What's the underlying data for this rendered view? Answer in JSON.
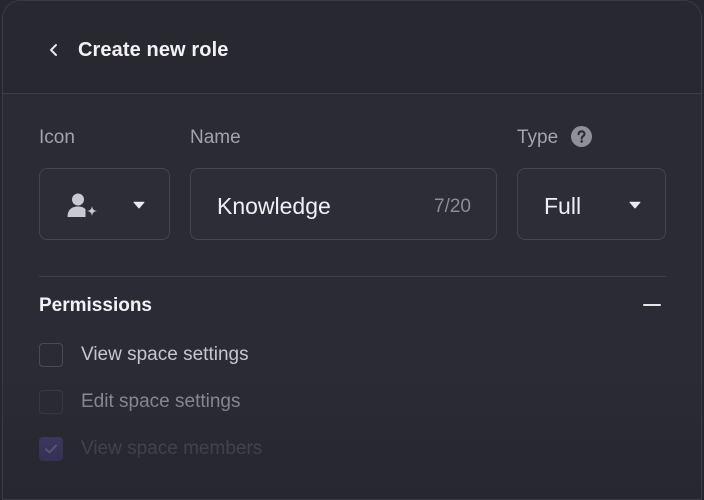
{
  "header": {
    "title": "Create new role",
    "back_icon": "chevron-left-icon"
  },
  "form": {
    "icon_label": "Icon",
    "icon_value": "user-plus-icon",
    "name_label": "Name",
    "name_value": "Knowledge",
    "name_counter": "7/20",
    "type_label": "Type",
    "type_value": "Full"
  },
  "permissions": {
    "title": "Permissions",
    "items": [
      {
        "label": "View space settings",
        "checked": false
      },
      {
        "label": "Edit space settings",
        "checked": false
      },
      {
        "label": "View space members",
        "checked": true
      }
    ]
  },
  "colors": {
    "background": "#2b2b35",
    "accent_checkbox": "#5b4fa8",
    "text_primary": "#f2f2f5",
    "text_muted": "#a3a3ad"
  }
}
